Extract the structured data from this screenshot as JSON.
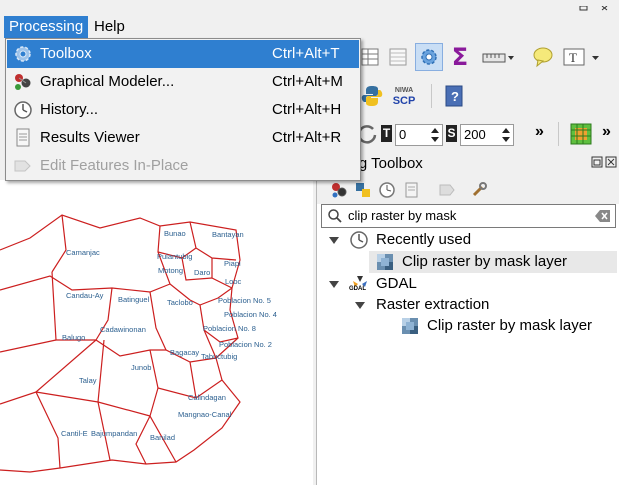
{
  "menubar": {
    "items": [
      {
        "label": "Processing"
      },
      {
        "label": "Help"
      }
    ]
  },
  "processing_menu": {
    "items": [
      {
        "label": "Toolbox",
        "shortcut": "Ctrl+Alt+T",
        "highlighted": true,
        "enabled": true,
        "icon": "gear-icon"
      },
      {
        "label": "Graphical Modeler...",
        "shortcut": "Ctrl+Alt+M",
        "highlighted": false,
        "enabled": true,
        "icon": "modeler-icon"
      },
      {
        "label": "History...",
        "shortcut": "Ctrl+Alt+H",
        "highlighted": false,
        "enabled": true,
        "icon": "history-clock-icon"
      },
      {
        "label": "Results Viewer",
        "shortcut": "Ctrl+Alt+R",
        "highlighted": false,
        "enabled": true,
        "icon": "document-icon"
      },
      {
        "label": "Edit Features In-Place",
        "shortcut": "",
        "highlighted": false,
        "enabled": false,
        "icon": "edit-in-place-icon"
      }
    ]
  },
  "toolbar": {
    "plugins": {
      "niwa_label": "NIWA",
      "scp_label": "SCP"
    },
    "spin_t": {
      "label": "T",
      "value": "0"
    },
    "spin_s": {
      "label": "S",
      "value": "200"
    },
    "more": "»",
    "more2": "»"
  },
  "toolbox": {
    "title": "Processing Toolbox",
    "search": {
      "value": "clip raster by mask"
    },
    "tree": {
      "recently_used": {
        "label": "Recently used",
        "children": [
          {
            "label": "Clip raster by mask layer"
          }
        ]
      },
      "gdal": {
        "label": "GDAL",
        "gdal_icon_text": "GDAL",
        "groups": [
          {
            "label": "Raster extraction",
            "children": [
              {
                "label": "Clip raster by mask layer"
              }
            ]
          }
        ]
      }
    }
  },
  "map": {
    "labels": [
      "Bunao",
      "Bantayan",
      "Camanjac",
      "Pulantubig",
      "Piapi",
      "Motong",
      "Daro",
      "Looc",
      "Candau-Ay",
      "Batinguel",
      "Taclobo",
      "Poblacion No. 5",
      "Poblacion No. 4",
      "Cadawinonan",
      "Balugo",
      "Poblacion No. 8",
      "Poblacion No. 2",
      "Bagacay",
      "Tabuctubig",
      "Junob",
      "Talay",
      "Calindagan",
      "Mangnao-Canal",
      "Cantil-E",
      "Bajumpandan",
      "Banilad"
    ]
  },
  "colors": {
    "accent": "#2f7fd0",
    "boundary": "#cc1f1f",
    "label": "#2b5f8f",
    "sum": "#8a1a9b"
  }
}
